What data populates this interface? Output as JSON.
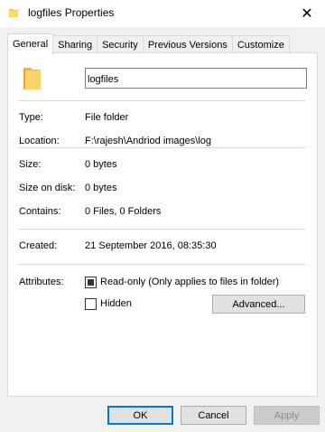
{
  "window": {
    "title": "logfiles Properties",
    "close_glyph": "✕"
  },
  "tabs": [
    {
      "label": "General",
      "active": true
    },
    {
      "label": "Sharing"
    },
    {
      "label": "Security"
    },
    {
      "label": "Previous Versions"
    },
    {
      "label": "Customize"
    }
  ],
  "general": {
    "name_value": "logfiles",
    "rows": {
      "type": {
        "label": "Type:",
        "value": "File folder"
      },
      "location": {
        "label": "Location:",
        "value": "F:\\rajesh\\Andriod images\\log"
      },
      "size": {
        "label": "Size:",
        "value": "0 bytes"
      },
      "size_on_disk": {
        "label": "Size on disk:",
        "value": "0 bytes"
      },
      "contains": {
        "label": "Contains:",
        "value": "0 Files, 0 Folders"
      },
      "created": {
        "label": "Created:",
        "value": "21 September 2016, 08:35:30"
      }
    },
    "attributes": {
      "label": "Attributes:",
      "readonly_label": "Read-only (Only applies to files in folder)",
      "readonly_checked": true,
      "hidden_label": "Hidden",
      "hidden_checked": false,
      "advanced_label": "Advanced..."
    }
  },
  "buttons": {
    "ok": "OK",
    "cancel": "Cancel",
    "apply": "Apply"
  },
  "colors": {
    "folder": "#f5c84f",
    "accent": "#0078d7"
  },
  "icons": {
    "title_icon": "folder-icon",
    "large_icon": "folder-icon"
  }
}
